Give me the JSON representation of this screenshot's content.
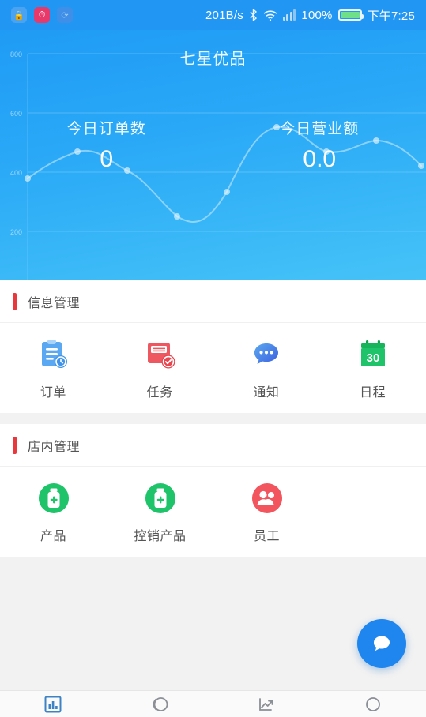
{
  "status_bar": {
    "apps": [
      "lock-icon",
      "clock-icon",
      "sync-icon"
    ],
    "network_speed": "201B/s",
    "bluetooth": "bluetooth-icon",
    "wifi": "wifi-icon",
    "signal": "signal-icon",
    "battery_percent": "100%",
    "time": "下午7:25"
  },
  "header": {
    "title": "七星优品",
    "stats": [
      {
        "label": "今日订单数",
        "value": "0"
      },
      {
        "label": "今日营业额",
        "value": "0.0"
      }
    ]
  },
  "chart_data": {
    "type": "line",
    "title": "七星优品",
    "xlabel": "",
    "ylabel": "",
    "x": [
      0,
      1,
      2,
      3,
      4,
      5,
      6,
      7,
      8
    ],
    "values": [
      380,
      470,
      420,
      330,
      250,
      560,
      470,
      500,
      420
    ],
    "categories": [
      "0",
      "1",
      "2",
      "3",
      "4",
      "5",
      "6",
      "7",
      "8"
    ],
    "xticks": [
      "0",
      "1",
      "2",
      "3",
      "4",
      "5",
      "6",
      "7",
      "8"
    ],
    "yticks": [
      "0",
      "200",
      "400",
      "600",
      "800"
    ],
    "xlim": [
      0,
      8
    ],
    "ylim": [
      0,
      800
    ],
    "grid": true,
    "legend": "none",
    "line_color": "#cfeaff",
    "background": "#29a8f7"
  },
  "sections": [
    {
      "title": "信息管理",
      "items": [
        {
          "label": "订单",
          "icon": "clipboard-clock-icon",
          "color": "#4a9cf0"
        },
        {
          "label": "任务",
          "icon": "folder-check-icon",
          "color": "#ef5760"
        },
        {
          "label": "通知",
          "icon": "chat-dots-icon",
          "color": "#3f7df0"
        },
        {
          "label": "日程",
          "icon": "calendar-icon",
          "color": "#1fb75e",
          "day": "30"
        }
      ]
    },
    {
      "title": "店内管理",
      "items": [
        {
          "label": "产品",
          "icon": "medicine-bottle-icon",
          "color": "#1fc46a"
        },
        {
          "label": "控销产品",
          "icon": "medicine-bottle-icon",
          "color": "#1fc46a"
        },
        {
          "label": "员工",
          "icon": "people-icon",
          "color": "#f2555e"
        }
      ]
    }
  ],
  "fab": {
    "icon": "chat-bubble-icon",
    "color": "#1f86f0"
  },
  "bottom_nav": [
    {
      "icon": "bar-chart-icon",
      "active": true
    },
    {
      "icon": "message-circle-icon",
      "active": false
    },
    {
      "icon": "trend-up-icon",
      "active": false
    },
    {
      "icon": "profile-circle-icon",
      "active": false
    }
  ],
  "theme": {
    "accent": "#e8383d",
    "primary": "#29a8f7",
    "nav_active": "#3d82c4"
  }
}
